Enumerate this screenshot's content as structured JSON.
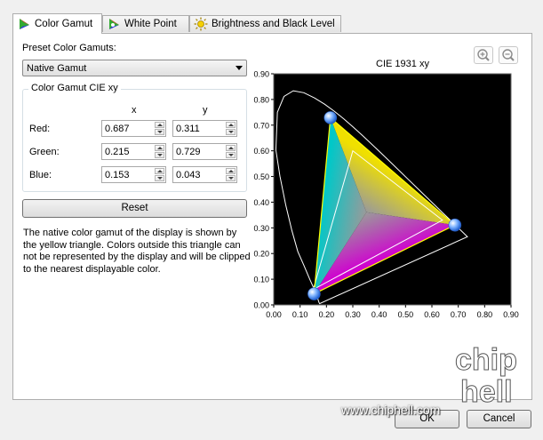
{
  "tabs": [
    {
      "label": "Color Gamut",
      "icon": "color-triangle-icon",
      "active": true
    },
    {
      "label": "White Point",
      "icon": "white-point-icon",
      "active": false
    },
    {
      "label": "Brightness and Black Level",
      "icon": "sun-icon",
      "active": false
    }
  ],
  "preset": {
    "label": "Preset Color Gamuts:",
    "selected": "Native Gamut"
  },
  "gamut_group": {
    "title": "Color Gamut CIE xy",
    "col_x": "x",
    "col_y": "y",
    "rows": [
      {
        "label": "Red:",
        "x": "0.687",
        "y": "0.311"
      },
      {
        "label": "Green:",
        "x": "0.215",
        "y": "0.729"
      },
      {
        "label": "Blue:",
        "x": "0.153",
        "y": "0.043"
      }
    ]
  },
  "reset_label": "Reset",
  "description": "The native color gamut of the display is shown by the yellow triangle. Colors outside this triangle can not be represented by the display and will be clipped to the nearest displayable color.",
  "zoom_in_icon": "zoom-in-icon",
  "zoom_out_icon": "zoom-out-icon",
  "ok_label": "OK",
  "cancel_label": "Cancel",
  "watermark_text": "www.chiphell.com",
  "watermark_logo": "chip hell",
  "chart_data": {
    "type": "scatter",
    "title": "CIE 1931 xy",
    "xlim": [
      0,
      0.9
    ],
    "ylim": [
      0,
      0.9
    ],
    "x_ticks": [
      "0.00",
      "0.10",
      "0.20",
      "0.30",
      "0.40",
      "0.50",
      "0.60",
      "0.70",
      "0.80",
      "0.90"
    ],
    "y_ticks": [
      "0.00",
      "0.10",
      "0.20",
      "0.30",
      "0.40",
      "0.50",
      "0.60",
      "0.70",
      "0.80",
      "0.90"
    ],
    "grid": false,
    "background": "#000000",
    "gamut_points": [
      {
        "name": "Red",
        "x": 0.687,
        "y": 0.311
      },
      {
        "name": "Green",
        "x": 0.215,
        "y": 0.729
      },
      {
        "name": "Blue",
        "x": 0.153,
        "y": 0.043
      }
    ],
    "reference_triangle": [
      [
        0.64,
        0.33
      ],
      [
        0.3,
        0.6
      ],
      [
        0.15,
        0.06
      ]
    ],
    "spectral_locus": [
      [
        0.1741,
        0.005
      ],
      [
        0.1714,
        0.0101
      ],
      [
        0.168,
        0.0213
      ],
      [
        0.1566,
        0.0543
      ],
      [
        0.1375,
        0.0979
      ],
      [
        0.1141,
        0.1547
      ],
      [
        0.0913,
        0.2079
      ],
      [
        0.0687,
        0.2901
      ],
      [
        0.0454,
        0.39
      ],
      [
        0.0235,
        0.5016
      ],
      [
        0.0082,
        0.6034
      ],
      [
        0.0139,
        0.7502
      ],
      [
        0.0389,
        0.812
      ],
      [
        0.0743,
        0.8338
      ],
      [
        0.1142,
        0.8262
      ],
      [
        0.1547,
        0.8059
      ],
      [
        0.1929,
        0.7816
      ],
      [
        0.2296,
        0.7543
      ],
      [
        0.2658,
        0.7243
      ],
      [
        0.3016,
        0.6923
      ],
      [
        0.3373,
        0.6589
      ],
      [
        0.3731,
        0.6245
      ],
      [
        0.4087,
        0.5896
      ],
      [
        0.4441,
        0.5547
      ],
      [
        0.4788,
        0.5202
      ],
      [
        0.5125,
        0.4866
      ],
      [
        0.5448,
        0.4544
      ],
      [
        0.5752,
        0.4242
      ],
      [
        0.6029,
        0.3965
      ],
      [
        0.627,
        0.3725
      ],
      [
        0.6482,
        0.3514
      ],
      [
        0.6658,
        0.334
      ],
      [
        0.6915,
        0.3083
      ],
      [
        0.7347,
        0.2653
      ]
    ]
  }
}
